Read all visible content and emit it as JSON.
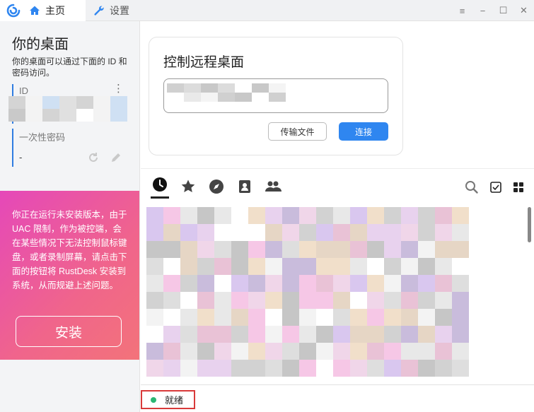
{
  "titlebar": {
    "tabs": [
      {
        "label": "主页",
        "icon": "home-icon"
      },
      {
        "label": "设置",
        "icon": "wrench-icon"
      }
    ],
    "window_buttons": {
      "menu": "≡",
      "minimize": "−",
      "maximize": "☐",
      "close": "✕"
    }
  },
  "left": {
    "title": "你的桌面",
    "description": "你的桌面可以通过下面的 ID 和密码访问。",
    "id_label": "ID",
    "password_label": "一次性密码",
    "password_value": "-",
    "warning": "你正在运行未安装版本，由于 UAC 限制，作为被控端，会在某些情况下无法控制鼠标键盘，或者录制屏幕，请点击下面的按钮将 RustDesk 安装到系统，从而规避上述问题。",
    "install_label": "安装"
  },
  "connect": {
    "title": "控制远程桌面",
    "transfer_label": "传输文件",
    "connect_label": "连接"
  },
  "peers": {
    "tabs": [
      "recent-icon",
      "star-icon",
      "compass-icon",
      "address-book-icon",
      "group-icon"
    ],
    "tools": [
      "search-icon",
      "checkbox-icon",
      "grid-view-icon"
    ]
  },
  "status": {
    "text": "就绪",
    "color": "#2bb673"
  },
  "colors": {
    "accent": "#2f86f0",
    "warning_gradient_start": "#e548b9",
    "warning_gradient_end": "#f3737a",
    "highlight_box": "#d93a3a"
  }
}
